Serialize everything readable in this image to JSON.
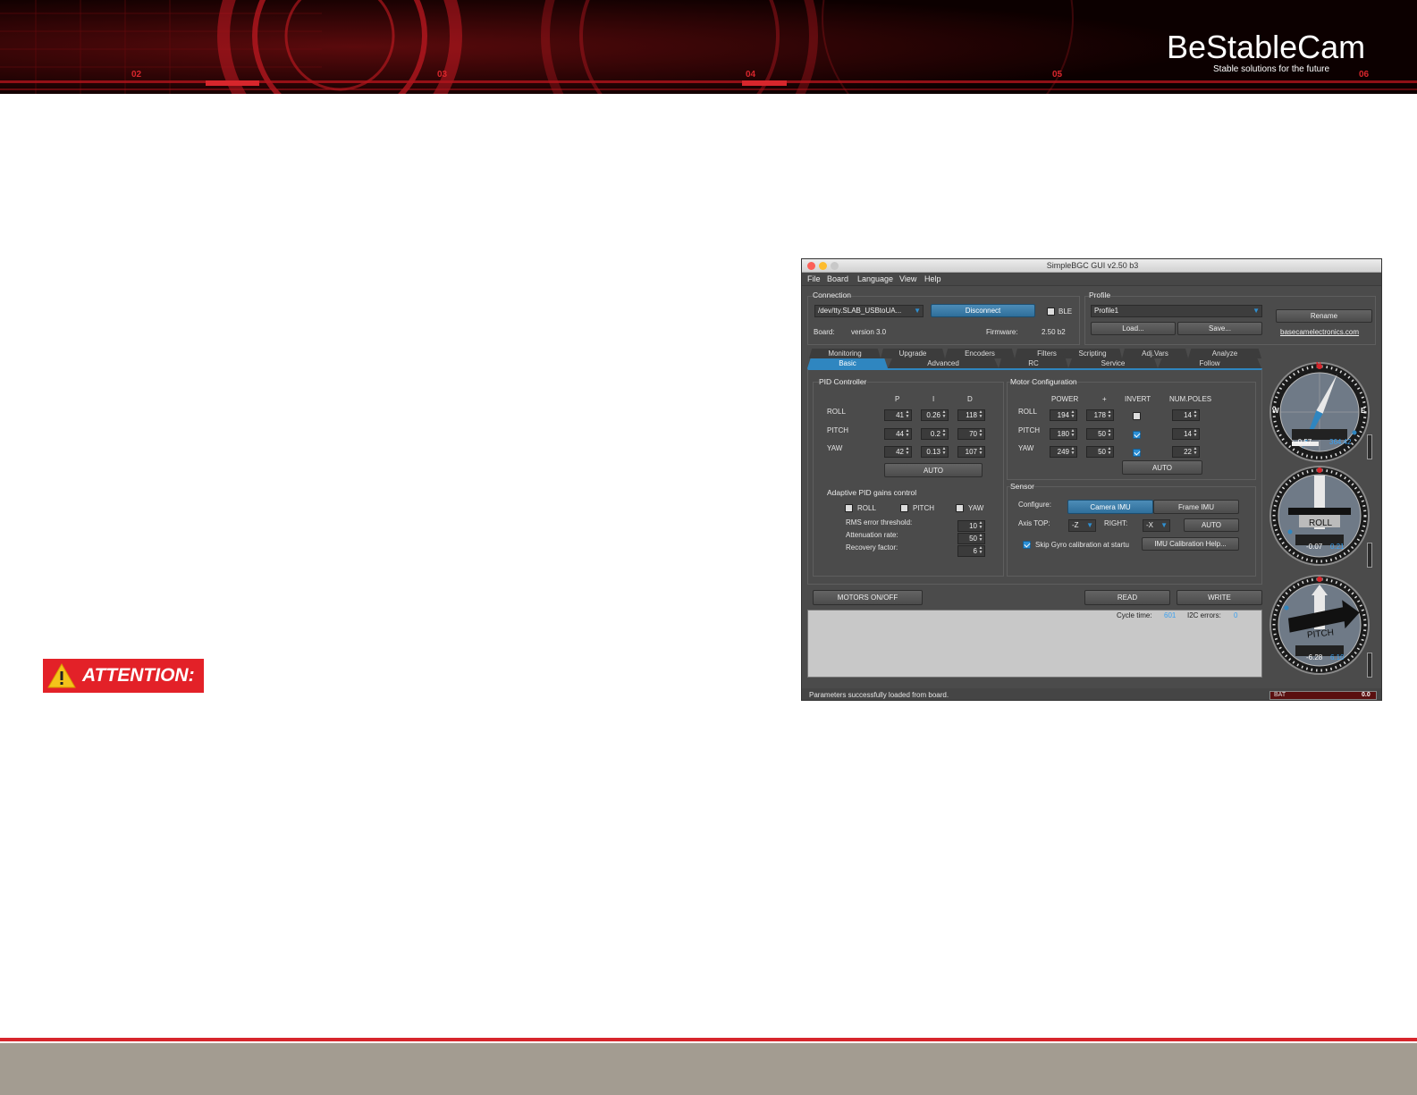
{
  "banner": {
    "numbers": [
      "02",
      "03",
      "04",
      "05",
      "06"
    ],
    "logo_text": "BeStableCam",
    "logo_tagline": "Stable solutions for the future"
  },
  "attention": {
    "label": "ATTENTION:"
  },
  "window": {
    "title": "SimpleBGC GUI v2.50 b3",
    "menu": [
      "File",
      "Board",
      "Language",
      "View",
      "Help"
    ],
    "connection": {
      "label": "Connection",
      "port": "/dev/tty.SLAB_USBtoUA...",
      "disconnect": "Disconnect",
      "ble": "BLE",
      "board_label": "Board:",
      "board_value": "version 3.0",
      "firmware_label": "Firmware:",
      "firmware_value": "2.50 b2"
    },
    "profile": {
      "label": "Profile",
      "value": "Profile1",
      "load": "Load...",
      "save": "Save...",
      "rename": "Rename",
      "link": "basecamelectronics.com"
    },
    "tabs_top": [
      "Monitoring",
      "Upgrade",
      "Encoders",
      "Filters",
      "Scripting",
      "Adj.Vars",
      "Analyze"
    ],
    "tabs_bottom": [
      "Basic",
      "Advanced",
      "RC",
      "Service",
      "Follow"
    ],
    "pid": {
      "label": "PID Controller",
      "headers": [
        "P",
        "I",
        "D"
      ],
      "rows": [
        {
          "axis": "ROLL",
          "p": "41",
          "i": "0.26",
          "d": "118"
        },
        {
          "axis": "PITCH",
          "p": "44",
          "i": "0.2",
          "d": "70"
        },
        {
          "axis": "YAW",
          "p": "42",
          "i": "0.13",
          "d": "107"
        }
      ],
      "auto": "AUTO"
    },
    "adaptive": {
      "label": "Adaptive PID gains control",
      "checks": [
        "ROLL",
        "PITCH",
        "YAW"
      ],
      "fields": [
        {
          "label": "RMS error threshold:",
          "value": "10"
        },
        {
          "label": "Attenuation rate:",
          "value": "50"
        },
        {
          "label": "Recovery factor:",
          "value": "6"
        }
      ]
    },
    "motor": {
      "label": "Motor Configuration",
      "headers": [
        "POWER",
        "+",
        "INVERT",
        "NUM.POLES"
      ],
      "rows": [
        {
          "axis": "ROLL",
          "power": "194",
          "plus": "178",
          "invert": false,
          "poles": "14"
        },
        {
          "axis": "PITCH",
          "power": "180",
          "plus": "50",
          "invert": true,
          "poles": "14"
        },
        {
          "axis": "YAW",
          "power": "249",
          "plus": "50",
          "invert": true,
          "poles": "22"
        }
      ],
      "auto": "AUTO"
    },
    "sensor": {
      "label": "Sensor",
      "configure_label": "Configure:",
      "camera_imu": "Camera IMU",
      "frame_imu": "Frame IMU",
      "axis_top_label": "Axis TOP:",
      "axis_top_value": "-Z",
      "right_label": "RIGHT:",
      "right_value": "-X",
      "auto": "AUTO",
      "skip_gyro": "Skip Gyro calibration at startu",
      "imu_help": "IMU Calibration Help..."
    },
    "actions": {
      "motors": "MOTORS ON/OFF",
      "read": "READ",
      "write": "WRITE"
    },
    "log": {
      "cycle_label": "Cycle time:",
      "cycle_value": "601",
      "i2c_label": "I2C errors:",
      "i2c_value": "0"
    },
    "status": {
      "message": "Parameters successfully loaded from board.",
      "bat_label": "BAT",
      "bat_value": "0.0"
    },
    "gauges": {
      "yaw": {
        "n": "N",
        "w": "W",
        "e": "E",
        "v1": "-0.57",
        "v2": "364.42"
      },
      "roll": {
        "label": "ROLL",
        "v1": "-0.07",
        "v2": "0.21"
      },
      "pitch": {
        "label": "PITCH",
        "v1": "-6.28",
        "v2": "6.10"
      }
    }
  },
  "colors": {
    "brand_red": "#d7262c",
    "footer": "#a39c91",
    "accent_blue": "#2f86c0",
    "link_blue": "#3aa0f0"
  }
}
